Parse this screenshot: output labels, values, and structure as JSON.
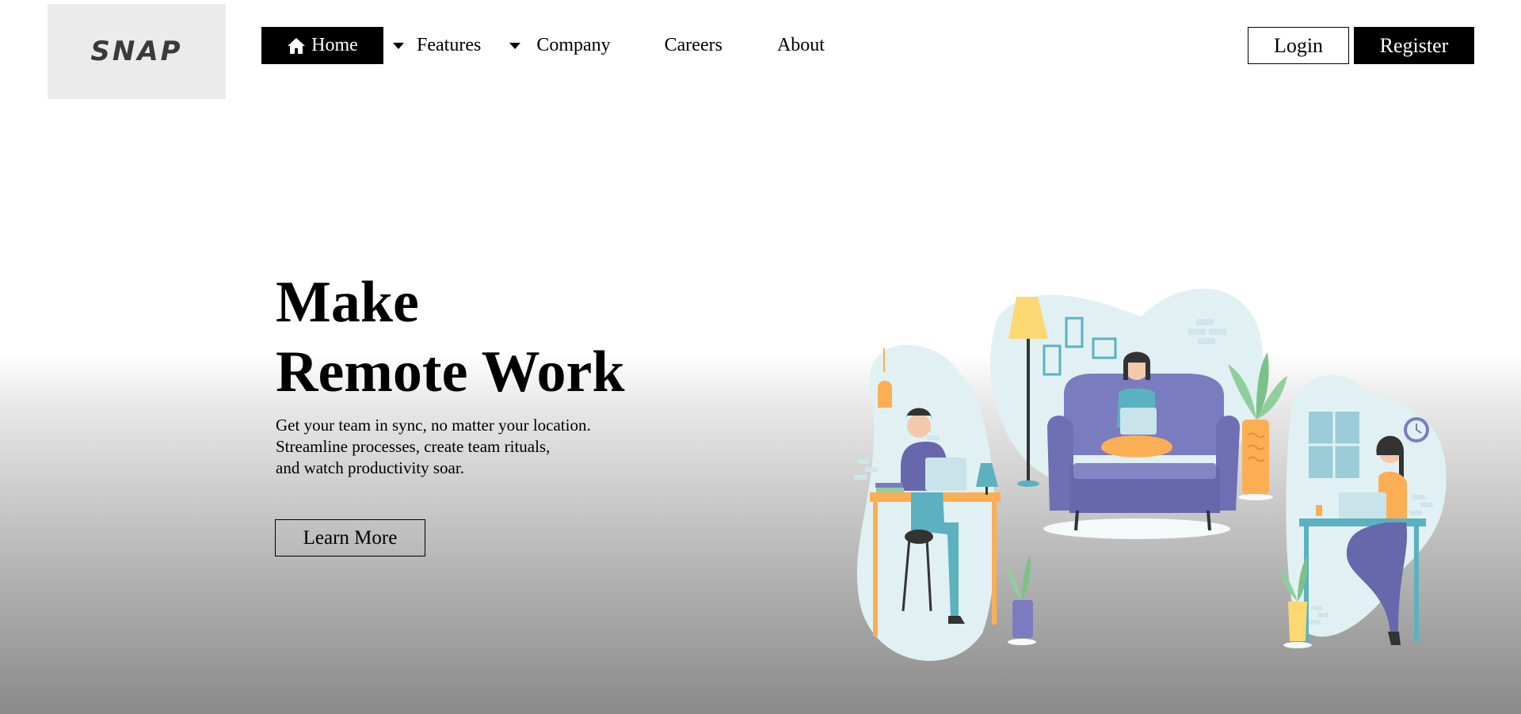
{
  "logo": {
    "text": "SNAP"
  },
  "nav": {
    "items": [
      {
        "label": "Home",
        "icon": "home-icon",
        "active": true
      },
      {
        "label": "Features",
        "dropdown": true
      },
      {
        "label": "Company",
        "dropdown": true
      },
      {
        "label": "Careers"
      },
      {
        "label": "About"
      }
    ]
  },
  "auth": {
    "login_label": "Login",
    "register_label": "Register"
  },
  "hero": {
    "title_line1": "Make",
    "title_line2": "Remote Work",
    "subtitle_line1": "Get your team in sync, no matter your location.",
    "subtitle_line2": "Streamline processes, create team rituals,",
    "subtitle_line3": "and watch productivity soar.",
    "cta_label": "Learn More"
  },
  "colors": {
    "accent": "#000000",
    "logo_bg": "#ebebeb",
    "illustration_purple": "#7b7bbf",
    "illustration_orange": "#fbae54",
    "illustration_teal": "#5bb1c0",
    "illustration_blob": "#e1f1f3"
  }
}
